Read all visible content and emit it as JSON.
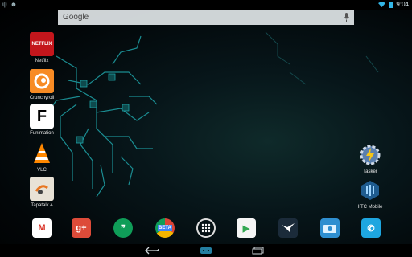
{
  "status": {
    "time": "9:04",
    "left_icons": [
      "usb-icon",
      "notification-icon"
    ],
    "right_icons": [
      "wifi-icon",
      "battery-icon"
    ]
  },
  "search": {
    "placeholder": "Google"
  },
  "apps": [
    {
      "label": "Netflix",
      "icon": "netflix-icon",
      "text": "NETFLIX",
      "color": "#c4161c"
    },
    {
      "label": "Crunchyroll",
      "icon": "crunchyroll-icon",
      "text": "",
      "color": "#f78b24"
    },
    {
      "label": "Funimation",
      "icon": "funimation-icon",
      "text": "F",
      "color": "#ffffff"
    },
    {
      "label": "VLC",
      "icon": "vlc-icon",
      "text": "",
      "color": "#ff8800"
    },
    {
      "label": "Tapatalk 4",
      "icon": "tapatalk-icon",
      "text": "",
      "color": "#e8e2d6"
    },
    {
      "label": "Tasker",
      "icon": "tasker-icon",
      "text": "",
      "color": "#3a5f9e"
    },
    {
      "label": "IITC Mobile",
      "icon": "iitc-icon",
      "text": "",
      "color": "#2a6fa8"
    }
  ],
  "dock": [
    {
      "name": "gmail-icon",
      "text": "M",
      "bg": "#ffffff",
      "fg": "#d93025"
    },
    {
      "name": "google-plus-icon",
      "text": "g+",
      "bg": "#dd4b39",
      "fg": "#ffffff"
    },
    {
      "name": "hangouts-icon",
      "text": "❞",
      "bg": "#0f9d58",
      "fg": "#ffffff"
    },
    {
      "name": "chrome-beta-icon",
      "text": "BETA",
      "bg": "#db4437",
      "fg": "#ffffff"
    },
    {
      "name": "app-drawer-icon",
      "text": "",
      "bg": "transparent",
      "fg": "#ffffff"
    },
    {
      "name": "play-store-icon",
      "text": "▶",
      "bg": "#f5f5f5",
      "fg": "#34a853"
    },
    {
      "name": "falcon-pro-icon",
      "text": "",
      "bg": "#1b2b3a",
      "fg": "#ffffff"
    },
    {
      "name": "file-manager-icon",
      "text": "",
      "bg": "#2f8fd0",
      "fg": "#ffffff"
    },
    {
      "name": "phone-icon",
      "text": "✆",
      "bg": "#1ea6e0",
      "fg": "#ffffff"
    }
  ],
  "colors": {
    "accent": "#33b5e5",
    "circuit": "#1fa3a8"
  },
  "nav": [
    "back-icon",
    "home-icon",
    "recents-icon"
  ]
}
